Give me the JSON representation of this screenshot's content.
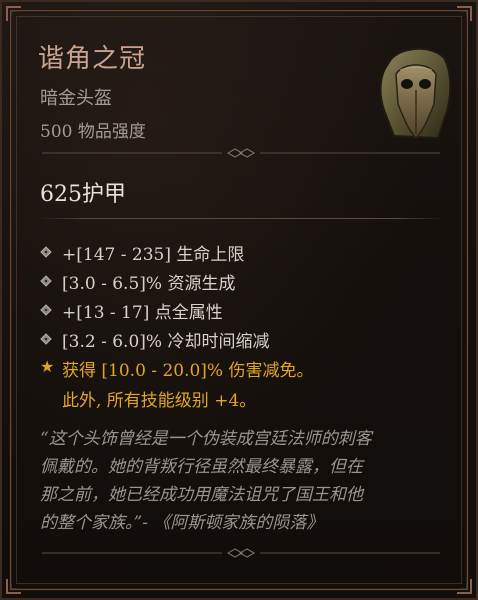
{
  "item": {
    "name": "谐角之冠",
    "type": "暗金头盔",
    "power": "500 物品强度"
  },
  "armor": "625护甲",
  "affixes": [
    "+[147 - 235] 生命上限",
    "[3.0 - 6.5]% 资源生成",
    "+[13 - 17] 点全属性",
    "[3.2 - 6.0]% 冷却时间缩减"
  ],
  "unique_power": {
    "line1": "获得 [10.0 - 20.0]% 伤害减免。",
    "line2": "此外, 所有技能级别 +4。"
  },
  "flavor_lines": [
    "“这个头饰曾经是一个伪装成宫廷法师的刺客",
    "佩戴的。她的背叛行径虽然最终暴露，但在",
    "那之前，她已经成功用魔法诅咒了国王和他",
    "的整个家族。”- 《阿斯顿家族的陨落》"
  ],
  "icons": {
    "affix_bullet": "diamond-bullet-icon",
    "unique_bullet": "star-icon",
    "item_image": "plague-mask-helm-icon"
  },
  "colors": {
    "unique_name": "#c9a38f",
    "unique_power": "#e3a524",
    "text": "#d8d0ca",
    "muted": "#a59b95"
  }
}
